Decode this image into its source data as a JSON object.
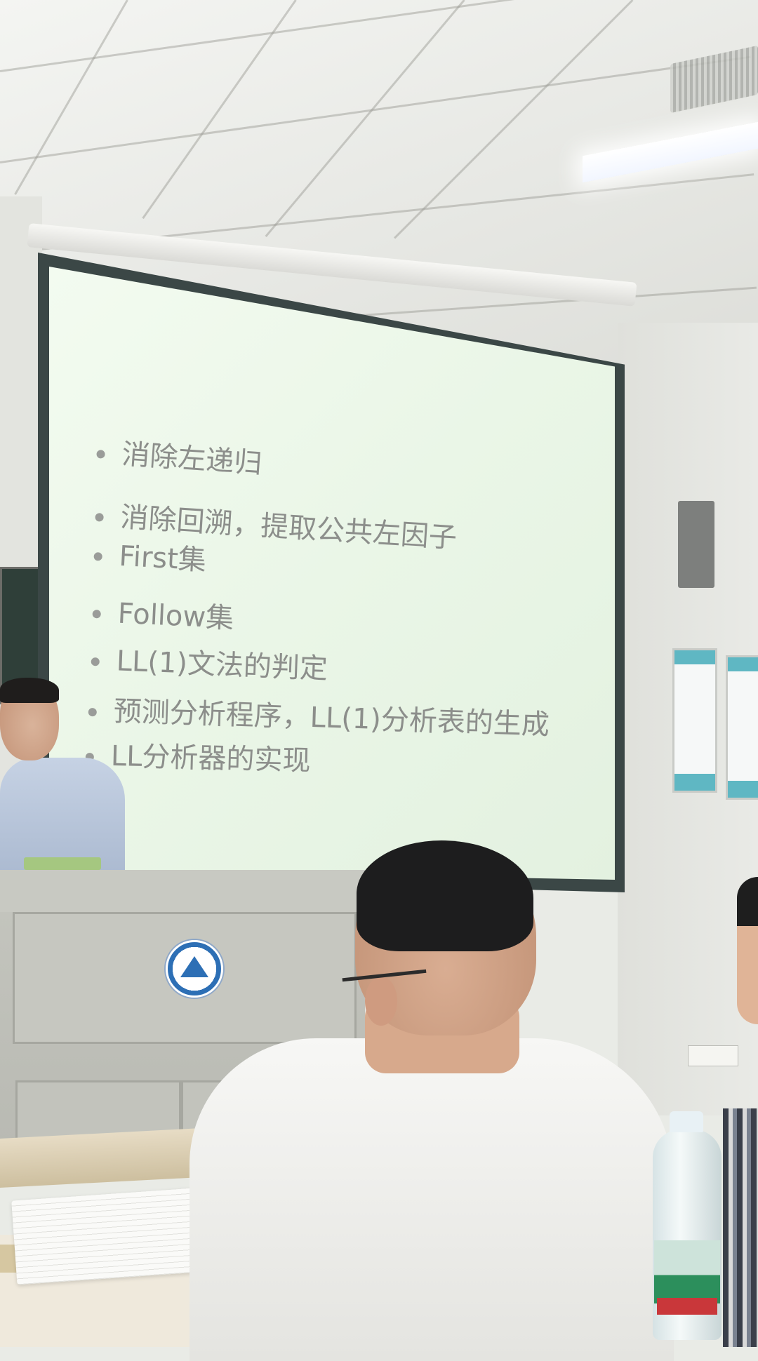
{
  "scene": {
    "description_colors": {
      "slide_background": "#eaf6e7",
      "slide_text": "#8c8e8b",
      "screen_frame": "#3b4746",
      "podium": "#c3c4bd",
      "logo_blue": "#2d6fb5"
    }
  },
  "slide": {
    "bullets": [
      "消除左递归",
      "消除回溯，提取公共左因子",
      "First集",
      "Follow集",
      "LL(1)文法的判定",
      "预测分析程序，LL(1)分析表的生成",
      "LL分析器的实现"
    ]
  }
}
